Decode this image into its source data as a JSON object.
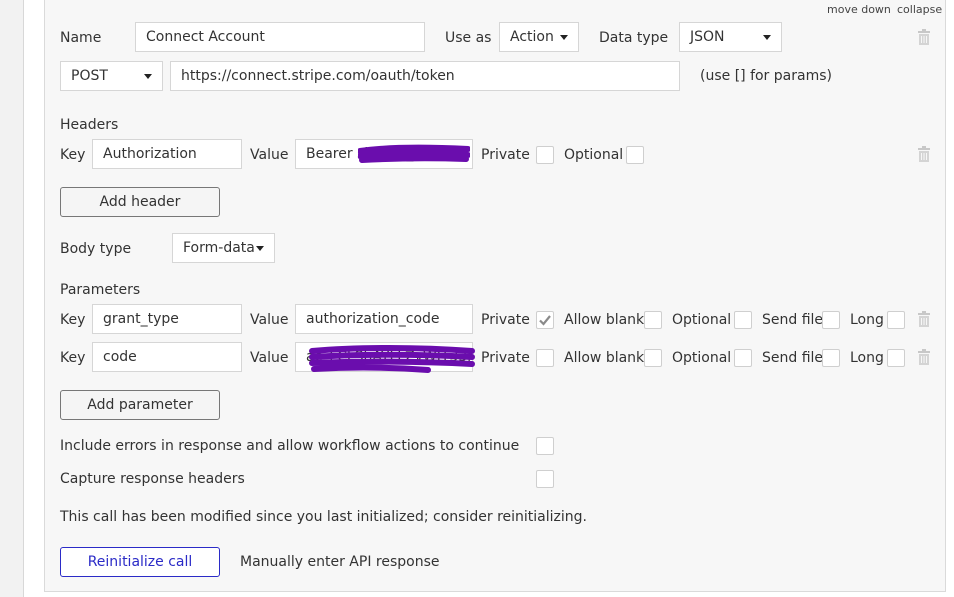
{
  "top_links": {
    "move_down": "move down",
    "collapse": "collapse"
  },
  "call": {
    "name_label": "Name",
    "name_value": "Connect Account",
    "use_as_label": "Use as",
    "use_as_value": "Action",
    "data_type_label": "Data type",
    "data_type_value": "JSON",
    "method": "POST",
    "url": "https://connect.stripe.com/oauth/token",
    "params_hint": "(use [] for params)"
  },
  "headers": {
    "title": "Headers",
    "key_label": "Key",
    "value_label": "Value",
    "rows": [
      {
        "key": "Authorization",
        "value": "Bearer sk_test_51Hp...",
        "private_label": "Private",
        "private": false,
        "optional_label": "Optional",
        "optional": false
      }
    ],
    "add_label": "Add header"
  },
  "body_type": {
    "label": "Body type",
    "value": "Form-data"
  },
  "parameters": {
    "title": "Parameters",
    "key_label": "Key",
    "value_label": "Value",
    "private_label": "Private",
    "allow_blank_label": "Allow blank",
    "optional_label": "Optional",
    "send_file_label": "Send file",
    "long_label": "Long",
    "rows": [
      {
        "key": "grant_type",
        "value": "authorization_code",
        "private": true,
        "allow_blank": false,
        "optional": false,
        "send_file": false,
        "long": false
      },
      {
        "key": "code",
        "value": "ac_LCLShAYLLZvWIT33k...",
        "private": false,
        "allow_blank": false,
        "optional": false,
        "send_file": false,
        "long": false
      }
    ],
    "add_label": "Add parameter"
  },
  "options": {
    "include_errors_label": "Include errors in response and allow workflow actions to continue",
    "include_errors": false,
    "capture_headers_label": "Capture response headers",
    "capture_headers": false
  },
  "notice": "This call has been modified since you last initialized; consider reinitializing.",
  "actions": {
    "reinitialize_label": "Reinitialize call",
    "manual_label": "Manually enter API response"
  },
  "colors": {
    "accent": "#2b2bc7",
    "redaction": "#6a0dad"
  },
  "icons": {
    "trash": "trash-icon",
    "check": "checkmark-icon",
    "dropdown": "chevron-down-icon"
  }
}
